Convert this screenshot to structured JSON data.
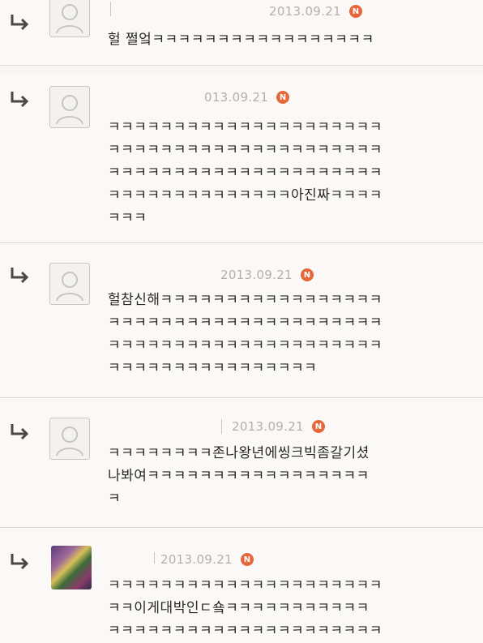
{
  "replies": [
    {
      "date": "2013.09.21",
      "badge": "N",
      "text": "헐 쩔엌ㅋㅋㅋㅋㅋㅋㅋㅋㅋㅋㅋㅋㅋㅋㅋㅋㅋ"
    },
    {
      "date": "013.09.21",
      "badge": "N",
      "text": "ㅋㅋㅋㅋㅋㅋㅋㅋㅋㅋㅋㅋㅋㅋㅋㅋㅋㅋㅋㅋㅋ\nㅋㅋㅋㅋㅋㅋㅋㅋㅋㅋㅋㅋㅋㅋㅋㅋㅋㅋㅋㅋㅋ\nㅋㅋㅋㅋㅋㅋㅋㅋㅋㅋㅋㅋㅋㅋㅋㅋㅋㅋㅋㅋㅋ\nㅋㅋㅋㅋㅋㅋㅋㅋㅋㅋㅋㅋㅋㅋ아진짜ㅋㅋㅋㅋ\nㅋㅋㅋ"
    },
    {
      "date": "2013.09.21",
      "badge": "N",
      "text": "헐참신해ㅋㅋㅋㅋㅋㅋㅋㅋㅋㅋㅋㅋㅋㅋㅋㅋㅋ\nㅋㅋㅋㅋㅋㅋㅋㅋㅋㅋㅋㅋㅋㅋㅋㅋㅋㅋㅋㅋㅋ\nㅋㅋㅋㅋㅋㅋㅋㅋㅋㅋㅋㅋㅋㅋㅋㅋㅋㅋㅋㅋㅋ\nㅋㅋㅋㅋㅋㅋㅋㅋㅋㅋㅋㅋㅋㅋㅋㅋ"
    },
    {
      "date": "2013.09.21",
      "badge": "N",
      "text": "ㅋㅋㅋㅋㅋㅋㅋㅋ존나왕년에씽크빅좀갈기셨\n나봐여ㅋㅋㅋㅋㅋㅋㅋㅋㅋㅋㅋㅋㅋㅋㅋㅋㅋ\nㅋ"
    },
    {
      "date": "2013.09.21",
      "badge": "N",
      "text": "ㅋㅋㅋㅋㅋㅋㅋㅋㅋㅋㅋㅋㅋㅋㅋㅋㅋㅋㅋㅋㅋ\nㅋㅋ이게대박인ㄷ숔ㅋㅋㅋㅋㅋㅋㅋㅋㅋㅋㅋ\nㅋㅋㅋㅋㅋㅋㅋㅋㅋㅋㅋㅋㅋㅋㅋㅋㅋㅋㅋㅋㅋ"
    }
  ]
}
